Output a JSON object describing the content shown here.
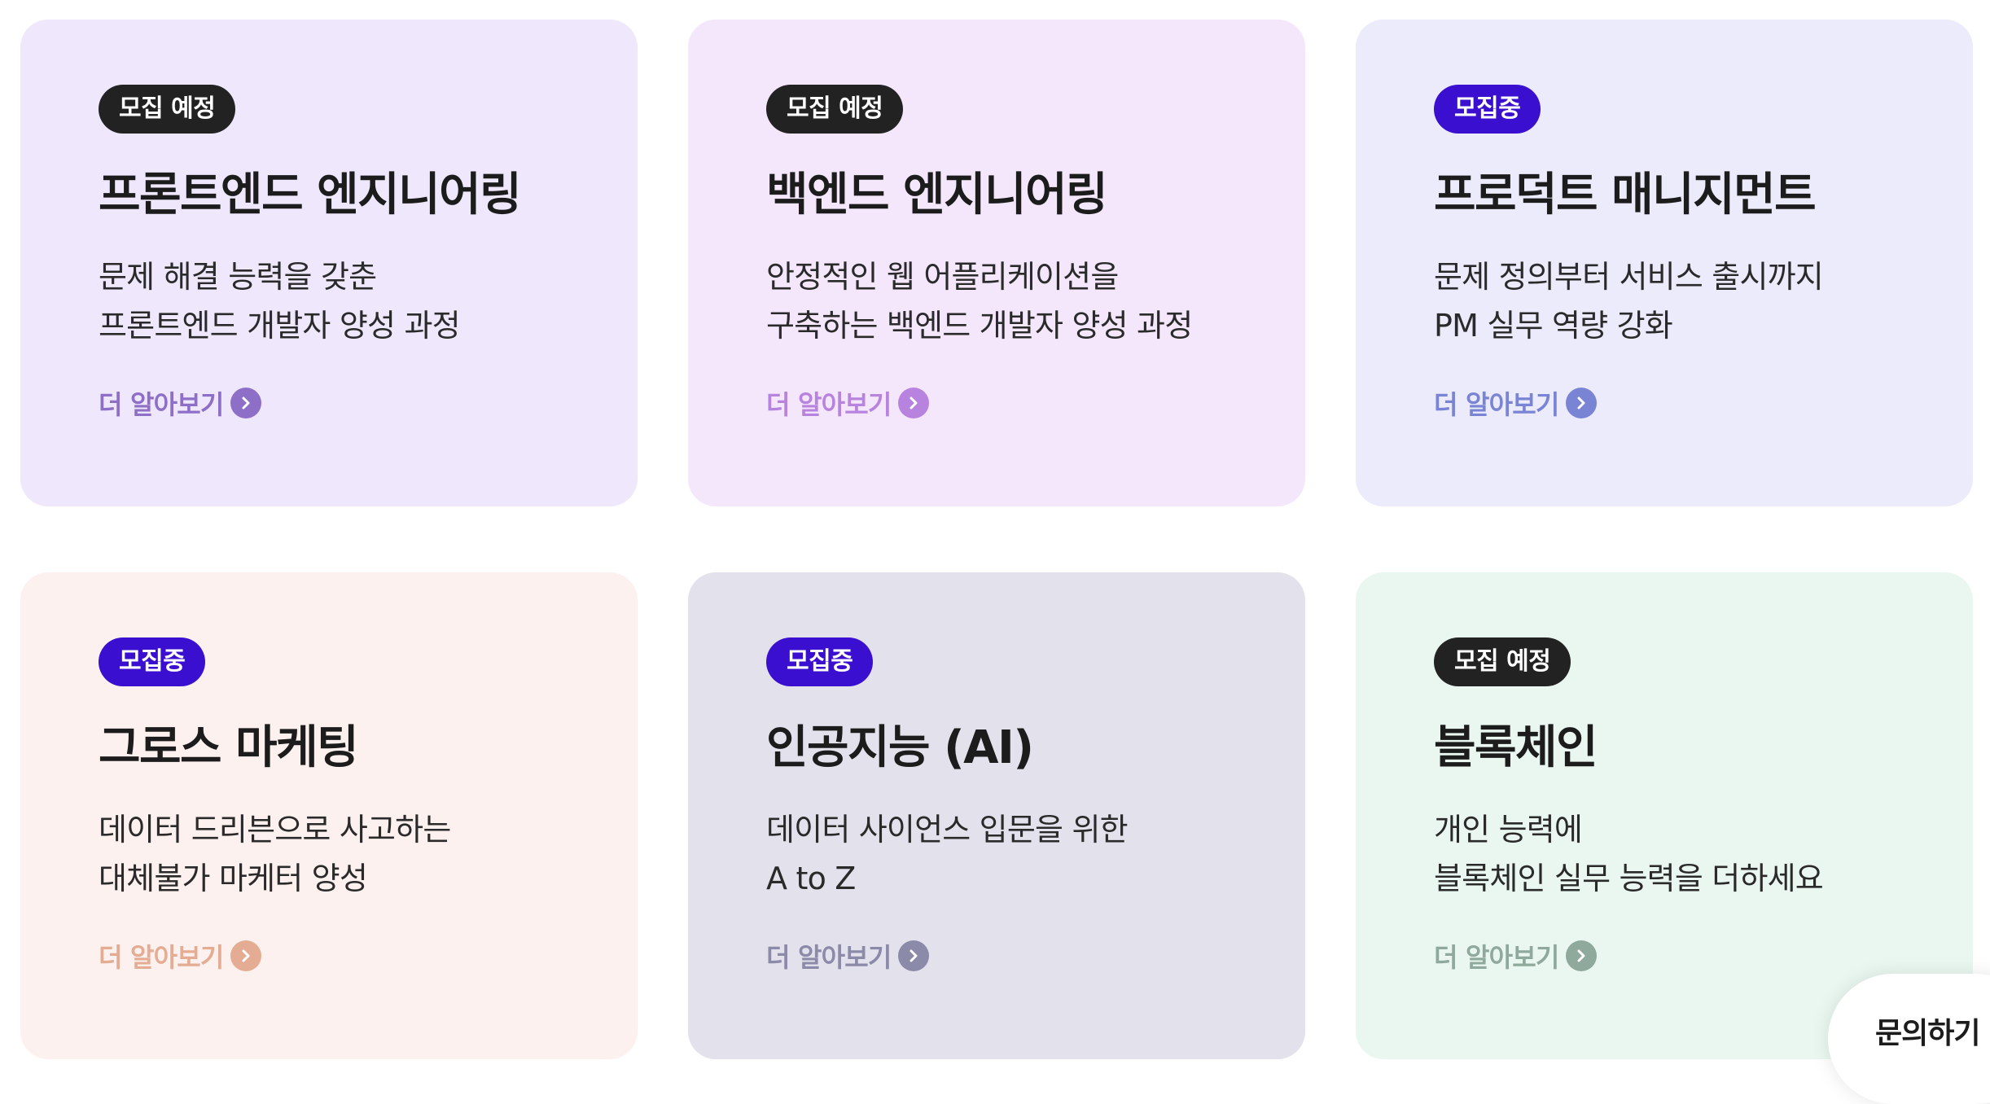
{
  "courses": [
    {
      "badge": "모집 예정",
      "status": "upcoming",
      "title": "프론트엔드 엔지니어링",
      "desc_line1": "문제 해결 능력을 갖춘",
      "desc_line2": "프론트엔드 개발자 양성 과정",
      "more": "더 알아보기",
      "bg_color": "#efe8fc",
      "accent_color": "#8e6fc8"
    },
    {
      "badge": "모집 예정",
      "status": "upcoming",
      "title": "백엔드 엔지니어링",
      "desc_line1": "안정적인 웹 어플리케이션을",
      "desc_line2": "구축하는 백엔드 개발자 양성 과정",
      "more": "더 알아보기",
      "bg_color": "#f4e7fc",
      "accent_color": "#b783de"
    },
    {
      "badge": "모집중",
      "status": "open",
      "title": "프로덕트 매니지먼트",
      "desc_line1": "문제 정의부터 서비스 출시까지",
      "desc_line2": "PM 실무 역량 강화",
      "more": "더 알아보기",
      "bg_color": "#ebebfc",
      "accent_color": "#7a84d4"
    },
    {
      "badge": "모집중",
      "status": "open",
      "title": "그로스 마케팅",
      "desc_line1": "데이터 드리븐으로 사고하는",
      "desc_line2": "대체불가 마케터 양성",
      "more": "더 알아보기",
      "bg_color": "#fcf1ee",
      "accent_color": "#e4ad93"
    },
    {
      "badge": "모집중",
      "status": "open",
      "title": "인공지능 (AI)",
      "desc_line1": "데이터 사이언스 입문을 위한",
      "desc_line2": "A to Z",
      "more": "더 알아보기",
      "bg_color": "#e3e2ec",
      "accent_color": "#8b8aa8"
    },
    {
      "badge": "모집 예정",
      "status": "upcoming",
      "title": "블록체인",
      "desc_line1": "개인 능력에",
      "desc_line2": "블록체인 실무 능력을 더하세요",
      "more": "더 알아보기",
      "bg_color": "#eaf7f1",
      "accent_color": "#8fa99c"
    }
  ],
  "inquiry_button": "문의하기",
  "icons": {
    "more_arrow": "chevron-right-circle-icon"
  },
  "colors": {
    "badge_upcoming": "#222222",
    "badge_open": "#3a0fd0"
  }
}
